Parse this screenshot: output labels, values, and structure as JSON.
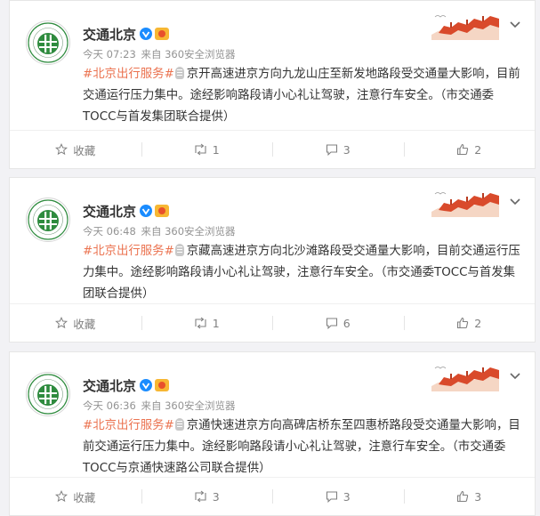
{
  "posts": [
    {
      "nick": "交通北京",
      "time": "今天 07:23",
      "source": "来自 360安全浏览器",
      "topic": "#北京出行服务#",
      "text": "京开高速进京方向九龙山庄至新发地路段受交通量大影响，目前交通运行压力集中。途经影响路段请小心礼让驾驶，注意行车安全。（市交通委TOCC与首发集团联合提供）",
      "actions": {
        "fav": "收藏",
        "repost": "1",
        "comment": "3",
        "like": "2"
      }
    },
    {
      "nick": "交通北京",
      "time": "今天 06:48",
      "source": "来自 360安全浏览器",
      "topic": "#北京出行服务#",
      "text": "京藏高速进京方向北沙滩路段受交通量大影响，目前交通运行压力集中。途经影响路段请小心礼让驾驶，注意行车安全。（市交通委TOCC与首发集团联合提供）",
      "actions": {
        "fav": "收藏",
        "repost": "1",
        "comment": "6",
        "like": "2"
      }
    },
    {
      "nick": "交通北京",
      "time": "今天 06:36",
      "source": "来自 360安全浏览器",
      "topic": "#北京出行服务#",
      "text": "京通快速进京方向高碑店桥东至四惠桥路段受交通量大影响，目前交通运行压力集中。途经影响路段请小心礼让驾驶，注意行车安全。（市交通委TOCC与京通快速路公司联合提供）",
      "actions": {
        "fav": "收藏",
        "repost": "3",
        "comment": "3",
        "like": "3"
      }
    }
  ],
  "colors": {
    "topic": "#eb7350",
    "verified": "#1a8cff",
    "action_text": "#808080",
    "logo_green": "#2e8b3e"
  },
  "icons": {
    "verified": "verified-v-icon",
    "level": "level-badge-icon",
    "voice": "microphone-icon",
    "fav": "star-icon",
    "repost": "repost-icon",
    "comment": "comment-icon",
    "like": "thumbs-up-icon",
    "menu": "chevron-down-icon",
    "decoration": "great-wall-decoration-icon"
  }
}
